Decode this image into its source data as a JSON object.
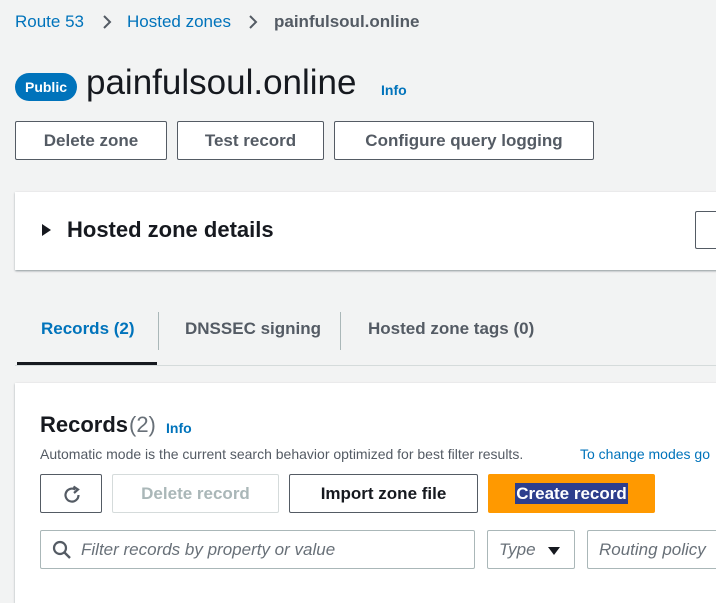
{
  "breadcrumb": {
    "items": [
      "Route 53",
      "Hosted zones"
    ],
    "current": "painfulsoul.online"
  },
  "header": {
    "badge": "Public",
    "title": "painfulsoul.online",
    "info": "Info"
  },
  "actions": {
    "delete_zone": "Delete zone",
    "test_record": "Test record",
    "configure_logging": "Configure query logging"
  },
  "details_panel": {
    "title": "Hosted zone details"
  },
  "tabs": [
    {
      "label": "Records (2)",
      "active": true
    },
    {
      "label": "DNSSEC signing",
      "active": false
    },
    {
      "label": "Hosted zone tags (0)",
      "active": false
    }
  ],
  "records": {
    "title": "Records",
    "count": "(2)",
    "info": "Info",
    "description": "Automatic mode is the current search behavior optimized for best filter results.",
    "description_link": "To change modes go",
    "delete_label": "Delete record",
    "import_label": "Import zone file",
    "create_label": "Create record",
    "search_placeholder": "Filter records by property or value",
    "type_filter": "Type",
    "routing_filter": "Routing policy"
  },
  "colors": {
    "link": "#0073bb",
    "primary_button": "#ff9900",
    "page_background": "#f2f3f3"
  },
  "icons": [
    "chevron-right-icon",
    "caret-right-icon",
    "refresh-icon",
    "search-icon",
    "caret-down-icon"
  ]
}
